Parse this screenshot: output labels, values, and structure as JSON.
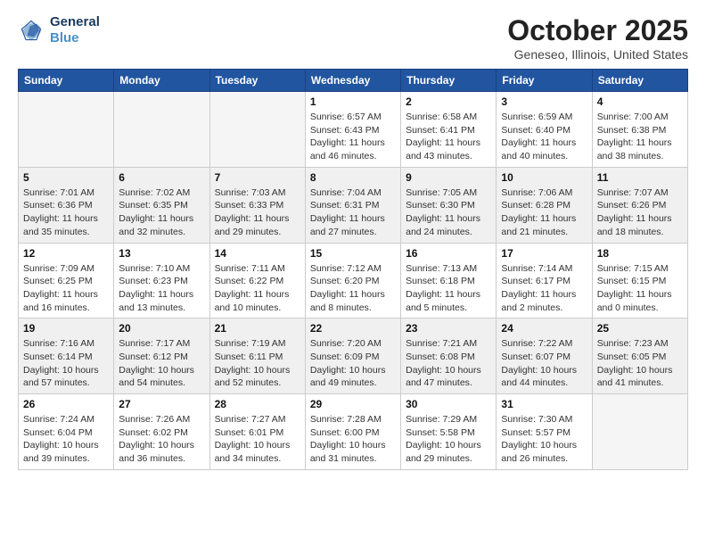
{
  "logo": {
    "line1": "General",
    "line2": "Blue"
  },
  "title": "October 2025",
  "subtitle": "Geneseo, Illinois, United States",
  "days_of_week": [
    "Sunday",
    "Monday",
    "Tuesday",
    "Wednesday",
    "Thursday",
    "Friday",
    "Saturday"
  ],
  "weeks": [
    [
      {
        "day": "",
        "info": ""
      },
      {
        "day": "",
        "info": ""
      },
      {
        "day": "",
        "info": ""
      },
      {
        "day": "1",
        "info": "Sunrise: 6:57 AM\nSunset: 6:43 PM\nDaylight: 11 hours and 46 minutes."
      },
      {
        "day": "2",
        "info": "Sunrise: 6:58 AM\nSunset: 6:41 PM\nDaylight: 11 hours and 43 minutes."
      },
      {
        "day": "3",
        "info": "Sunrise: 6:59 AM\nSunset: 6:40 PM\nDaylight: 11 hours and 40 minutes."
      },
      {
        "day": "4",
        "info": "Sunrise: 7:00 AM\nSunset: 6:38 PM\nDaylight: 11 hours and 38 minutes."
      }
    ],
    [
      {
        "day": "5",
        "info": "Sunrise: 7:01 AM\nSunset: 6:36 PM\nDaylight: 11 hours and 35 minutes."
      },
      {
        "day": "6",
        "info": "Sunrise: 7:02 AM\nSunset: 6:35 PM\nDaylight: 11 hours and 32 minutes."
      },
      {
        "day": "7",
        "info": "Sunrise: 7:03 AM\nSunset: 6:33 PM\nDaylight: 11 hours and 29 minutes."
      },
      {
        "day": "8",
        "info": "Sunrise: 7:04 AM\nSunset: 6:31 PM\nDaylight: 11 hours and 27 minutes."
      },
      {
        "day": "9",
        "info": "Sunrise: 7:05 AM\nSunset: 6:30 PM\nDaylight: 11 hours and 24 minutes."
      },
      {
        "day": "10",
        "info": "Sunrise: 7:06 AM\nSunset: 6:28 PM\nDaylight: 11 hours and 21 minutes."
      },
      {
        "day": "11",
        "info": "Sunrise: 7:07 AM\nSunset: 6:26 PM\nDaylight: 11 hours and 18 minutes."
      }
    ],
    [
      {
        "day": "12",
        "info": "Sunrise: 7:09 AM\nSunset: 6:25 PM\nDaylight: 11 hours and 16 minutes."
      },
      {
        "day": "13",
        "info": "Sunrise: 7:10 AM\nSunset: 6:23 PM\nDaylight: 11 hours and 13 minutes."
      },
      {
        "day": "14",
        "info": "Sunrise: 7:11 AM\nSunset: 6:22 PM\nDaylight: 11 hours and 10 minutes."
      },
      {
        "day": "15",
        "info": "Sunrise: 7:12 AM\nSunset: 6:20 PM\nDaylight: 11 hours and 8 minutes."
      },
      {
        "day": "16",
        "info": "Sunrise: 7:13 AM\nSunset: 6:18 PM\nDaylight: 11 hours and 5 minutes."
      },
      {
        "day": "17",
        "info": "Sunrise: 7:14 AM\nSunset: 6:17 PM\nDaylight: 11 hours and 2 minutes."
      },
      {
        "day": "18",
        "info": "Sunrise: 7:15 AM\nSunset: 6:15 PM\nDaylight: 11 hours and 0 minutes."
      }
    ],
    [
      {
        "day": "19",
        "info": "Sunrise: 7:16 AM\nSunset: 6:14 PM\nDaylight: 10 hours and 57 minutes."
      },
      {
        "day": "20",
        "info": "Sunrise: 7:17 AM\nSunset: 6:12 PM\nDaylight: 10 hours and 54 minutes."
      },
      {
        "day": "21",
        "info": "Sunrise: 7:19 AM\nSunset: 6:11 PM\nDaylight: 10 hours and 52 minutes."
      },
      {
        "day": "22",
        "info": "Sunrise: 7:20 AM\nSunset: 6:09 PM\nDaylight: 10 hours and 49 minutes."
      },
      {
        "day": "23",
        "info": "Sunrise: 7:21 AM\nSunset: 6:08 PM\nDaylight: 10 hours and 47 minutes."
      },
      {
        "day": "24",
        "info": "Sunrise: 7:22 AM\nSunset: 6:07 PM\nDaylight: 10 hours and 44 minutes."
      },
      {
        "day": "25",
        "info": "Sunrise: 7:23 AM\nSunset: 6:05 PM\nDaylight: 10 hours and 41 minutes."
      }
    ],
    [
      {
        "day": "26",
        "info": "Sunrise: 7:24 AM\nSunset: 6:04 PM\nDaylight: 10 hours and 39 minutes."
      },
      {
        "day": "27",
        "info": "Sunrise: 7:26 AM\nSunset: 6:02 PM\nDaylight: 10 hours and 36 minutes."
      },
      {
        "day": "28",
        "info": "Sunrise: 7:27 AM\nSunset: 6:01 PM\nDaylight: 10 hours and 34 minutes."
      },
      {
        "day": "29",
        "info": "Sunrise: 7:28 AM\nSunset: 6:00 PM\nDaylight: 10 hours and 31 minutes."
      },
      {
        "day": "30",
        "info": "Sunrise: 7:29 AM\nSunset: 5:58 PM\nDaylight: 10 hours and 29 minutes."
      },
      {
        "day": "31",
        "info": "Sunrise: 7:30 AM\nSunset: 5:57 PM\nDaylight: 10 hours and 26 minutes."
      },
      {
        "day": "",
        "info": ""
      }
    ]
  ]
}
